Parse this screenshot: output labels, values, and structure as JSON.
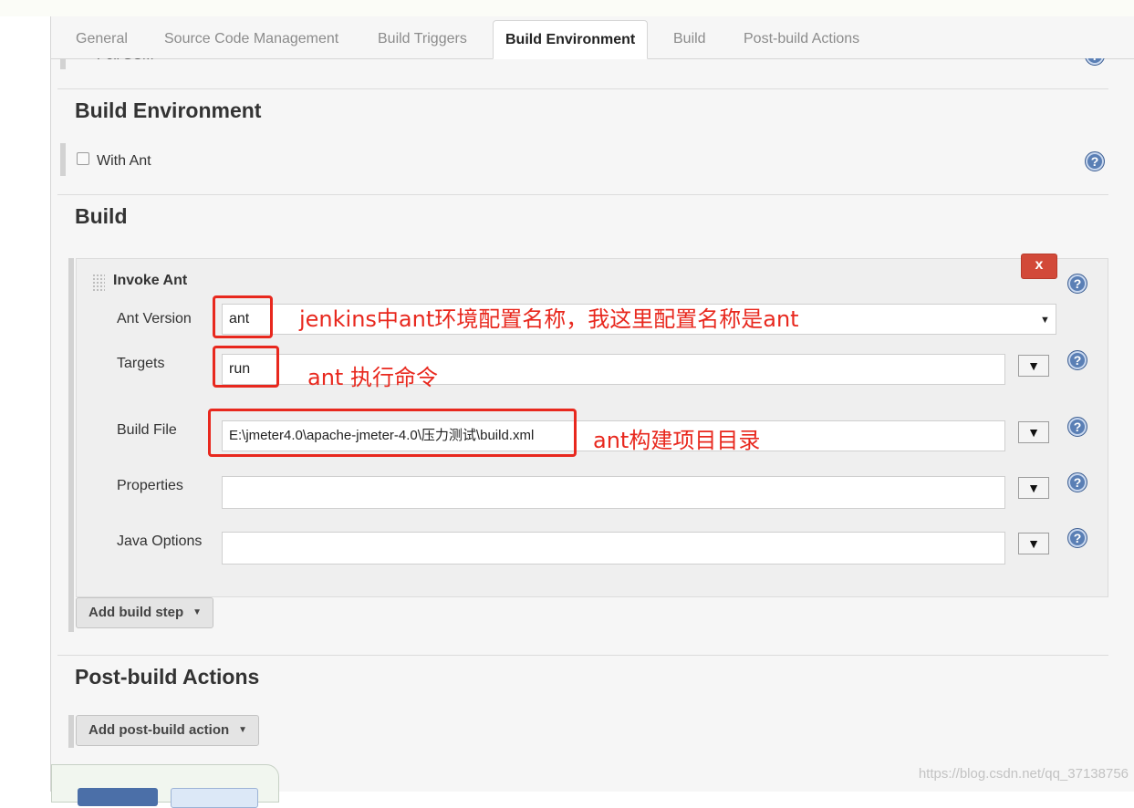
{
  "tabs": [
    {
      "label": "General"
    },
    {
      "label": "Source Code Management"
    },
    {
      "label": "Build Triggers"
    },
    {
      "label": "Build Environment"
    },
    {
      "label": "Build"
    },
    {
      "label": "Post-build Actions"
    }
  ],
  "partial_item": {
    "label": "Poll SCM"
  },
  "build_environment": {
    "title": "Build Environment",
    "with_ant_label": "With Ant"
  },
  "build": {
    "title": "Build",
    "invoke_ant": {
      "title": "Invoke Ant",
      "delete_label": "x",
      "ant_version": {
        "label": "Ant Version",
        "value": "ant"
      },
      "targets": {
        "label": "Targets",
        "value": "run"
      },
      "build_file": {
        "label": "Build File",
        "value": "E:\\jmeter4.0\\apache-jmeter-4.0\\压力测试\\build.xml"
      },
      "properties": {
        "label": "Properties",
        "value": ""
      },
      "java_options": {
        "label": "Java Options",
        "value": ""
      }
    },
    "add_build_step": "Add build step"
  },
  "post_build": {
    "title": "Post-build Actions",
    "add_action": "Add post-build action"
  },
  "annotations": {
    "ant_version": "jenkins中ant环境配置名称，我这里配置名称是ant",
    "targets": "ant 执行命令",
    "build_file": "ant构建项目目录"
  },
  "watermark": "https://blog.csdn.net/qq_37138756",
  "icons": {
    "help": "?",
    "expand": "▼",
    "caret": "▼"
  },
  "colors": {
    "annotation_red": "#e8281e",
    "help_blue": "#5a7fb5",
    "delete_red": "#d24939"
  }
}
